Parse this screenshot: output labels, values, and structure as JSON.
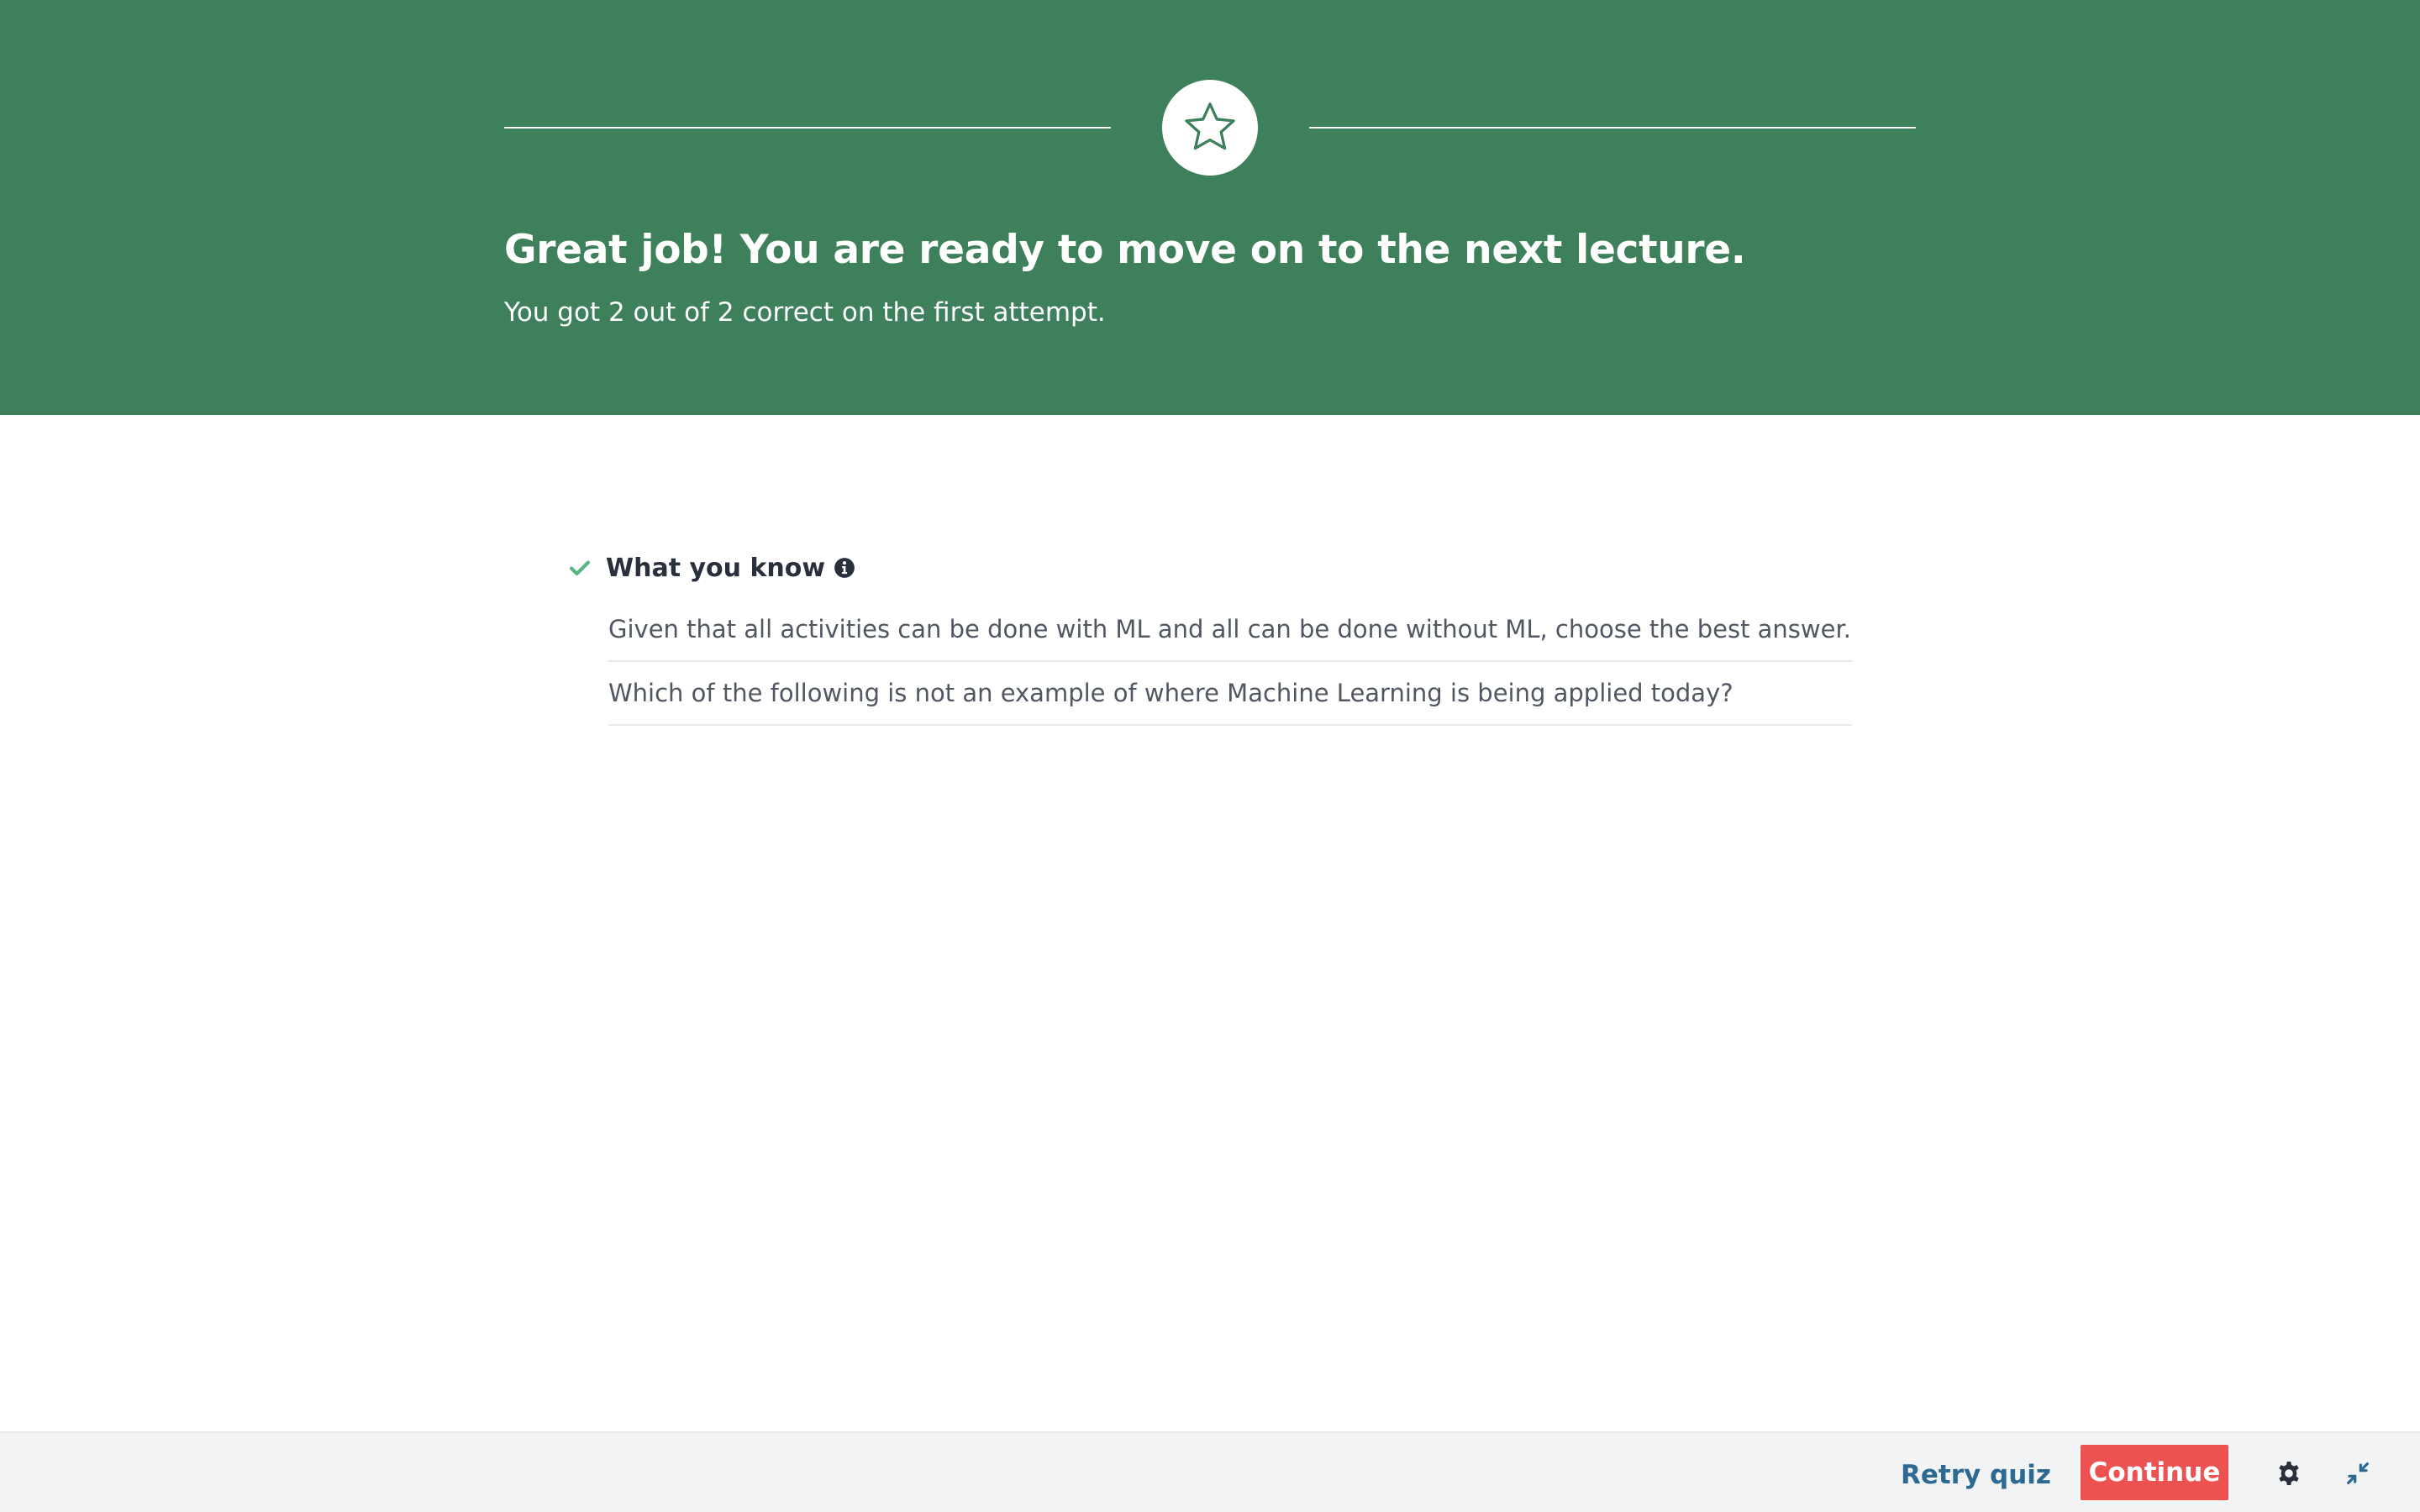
{
  "banner": {
    "title": "Great job! You are ready to move on to the next lecture.",
    "subtitle": "You got 2 out of 2 correct on the first attempt.",
    "icon": "star-icon",
    "background_color": "#3e805c"
  },
  "summary": {
    "section_title": "What you know",
    "status_icon": "check-icon",
    "info_icon": "info-icon",
    "questions": [
      "Given that all activities can be done with ML and all can be done without ML, choose the best answer. Whi...",
      "Which of the following is not an example of where Machine Learning is being applied today?"
    ]
  },
  "footer": {
    "retry_label": "Retry quiz",
    "continue_label": "Continue",
    "settings_icon": "gear-icon",
    "collapse_icon": "collapse-icon",
    "accent_color": "#ec5252",
    "link_color": "#2c6a91"
  }
}
